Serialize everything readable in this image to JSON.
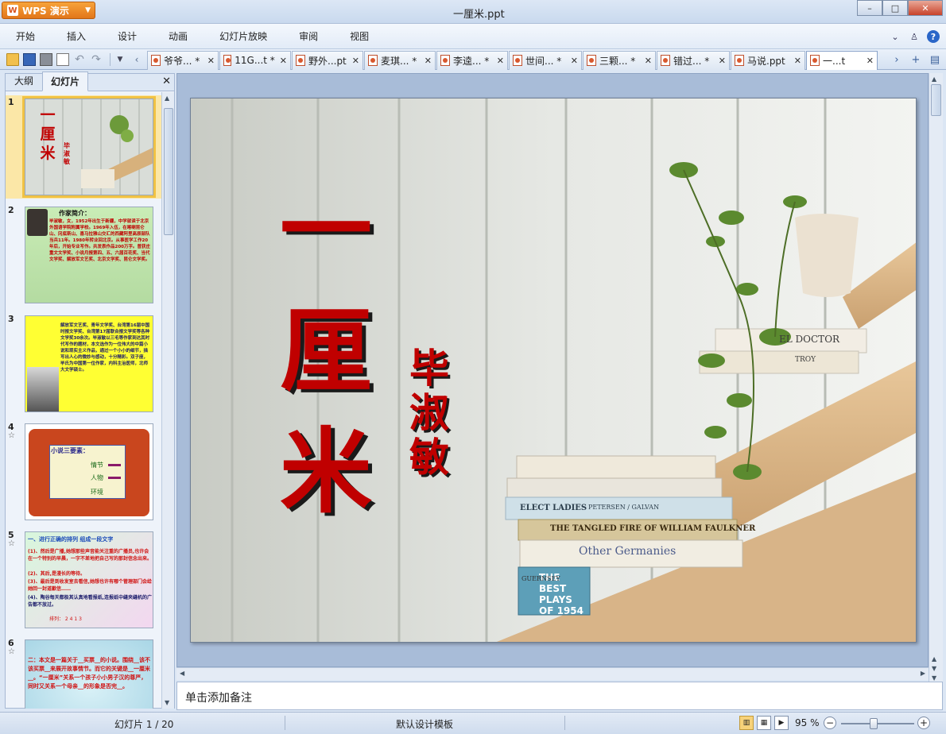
{
  "app": {
    "button_label": "WPS 演示",
    "window_title": "一厘米.ppt"
  },
  "window_controls": {
    "minimize": "–",
    "maximize": "□",
    "close": "✕"
  },
  "menu": [
    "开始",
    "插入",
    "设计",
    "动画",
    "幻灯片放映",
    "审阅",
    "视图"
  ],
  "tabs": [
    {
      "label": "爷爷... *"
    },
    {
      "label": "11G...t *"
    },
    {
      "label": "野外...pt"
    },
    {
      "label": "麦琪... *"
    },
    {
      "label": "李逵... *"
    },
    {
      "label": "世间... *"
    },
    {
      "label": "三颗... *"
    },
    {
      "label": "错过... *"
    },
    {
      "label": "马说.ppt"
    },
    {
      "label": "一...t"
    }
  ],
  "tab_close_glyph": "✕",
  "left_panel": {
    "tab_outline": "大纲",
    "tab_slides": "幻灯片",
    "close_glyph": "✕",
    "star_glyph": "☆",
    "slides": [
      {
        "num": "1",
        "title": "一厘米",
        "author": "毕淑敏"
      },
      {
        "num": "2",
        "heading": "作家简介：",
        "text": "毕淑敏，女，1952年出生于新疆，中学就读于北京外国语学院附属学校。1969年入伍，在喀喇昆仑山、冈底斯山、喜马拉雅山交汇的西藏阿里高原部队当兵11年。1980年转业回北京。从事医学工作20年后，开始专业写作。共发表作品200万字。曾获庄重文文学奖、小说月报第四、五、六届百花奖、当代文学奖、解放军文艺奖、北京文学奖、昆仑文学奖。"
      },
      {
        "num": "3",
        "text": "解放军文艺奖、青年文学奖、台湾第16届中国时报文学奖、台湾第17届联合报文学奖等各种文学奖30余次。毕淑敏以三毛等作家到达其时代写作的题材，本文选作为一位伟大的中篇小说和现实主义作品，通过一个小小的细节，描写出人心的微妙与感动，十分精彩。双子座，毕氏为中国第一位作家，内科主治医师，北师大文学硕士。"
      },
      {
        "num": "4",
        "heading": "小说三要素：",
        "items": [
          "情节",
          "人物",
          "环境"
        ]
      },
      {
        "num": "5",
        "heading": "一、进行正确的排列 组成一段文字",
        "lines": [
          "(1)、然后是广播,她想那些声音能关注重的广播员,也许会在一个特别的早晨，一字不差地把自己写的那封信念出来。",
          "(2)、其后,是漫长的等待。",
          "(3)、最后是到收发室去看信,她想也许有哪个管理部门会给她回一封道歉信……",
          "(4)、陶谷每天都极其认真地看报纸,连报纸中缝夹缝机的广告都不放过。",
          "排列： 2 4 1 3"
        ]
      },
      {
        "num": "6",
        "text": "二：本文是一篇关于__买票__的小说。围绕__该不该买票__来展开故事情节。而它的关键是__一厘米__。“一厘米”关系一个孩子小小男子汉的尊严，同时又关系一个母亲__的形象是否完__。"
      }
    ]
  },
  "slide": {
    "title_chars": [
      "一",
      "厘",
      "米"
    ],
    "author_chars": [
      "毕",
      "淑",
      "敏"
    ],
    "books": [
      "ELECT LADIES",
      "PETERSEN / GALVAN",
      "THE TANGLED FIRE OF WILLIAM FAULKNER",
      "Other Germanies",
      "THE BEST PLAYS OF 1954",
      "GUERNSEY",
      "EL DOCTOR",
      "TROY"
    ]
  },
  "notes_placeholder": "单击添加备注",
  "status": {
    "slide_counter": "幻灯片 1 / 20",
    "template": "默认设计模板",
    "zoom": "95 %",
    "zoom_level": 0.45
  },
  "colors": {
    "title_red": "#c00000",
    "wps_orange": "#e2761a",
    "selection_gold": "#f0c244"
  }
}
